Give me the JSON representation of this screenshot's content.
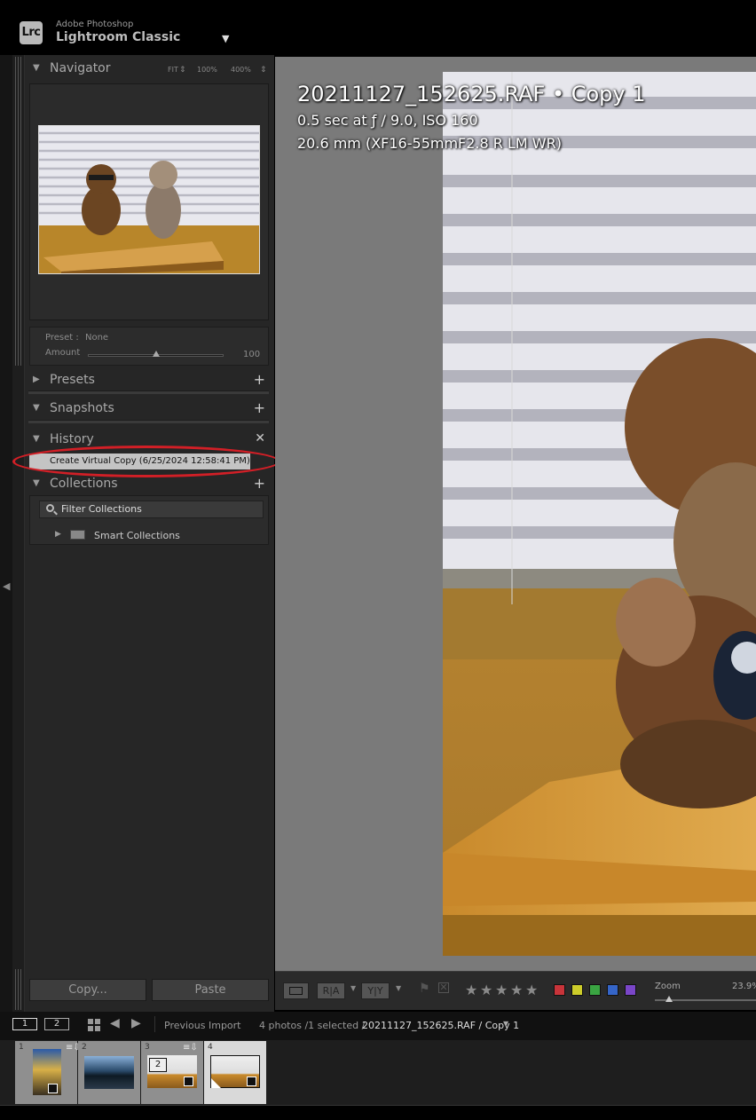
{
  "app": {
    "logo": "Lrc",
    "brand_small": "Adobe Photoshop",
    "brand_big": "Lightroom Classic"
  },
  "navigator": {
    "title": "Navigator",
    "zoom_fit": "FIT",
    "zoom_100": "100%",
    "zoom_400": "400%"
  },
  "quick_develop": {
    "preset_label": "Preset :",
    "preset_value": "None",
    "amount_label": "Amount",
    "amount_value": "100",
    "amount_level": 0.5
  },
  "panels": {
    "presets": "Presets",
    "snapshots": "Snapshots",
    "history": "History",
    "collections": "Collections"
  },
  "history": {
    "items": [
      "Create Virtual Copy (6/25/2024 12:58:41 PM)"
    ]
  },
  "collections": {
    "filter_placeholder": "Filter Collections",
    "smart": "Smart Collections"
  },
  "buttons": {
    "copy": "Copy...",
    "paste": "Paste"
  },
  "photo_info": {
    "title": "20211127_152625.RAF  •  Copy 1",
    "exposure": "0.5 sec at ƒ / 9.0, ISO 160",
    "lens": "20.6 mm (XF16-55mmF2.8 R LM WR)"
  },
  "toolbar": {
    "ra_label": "R|A",
    "yy_label": "Y|Y",
    "zoom_label": "Zoom",
    "zoom_value": "23.9%",
    "colors": [
      "#c8343a",
      "#cccc2a",
      "#3aa542",
      "#3565c8",
      "#7a46c8"
    ]
  },
  "filmstrip": {
    "screen1": "1",
    "screen2": "2",
    "source": "Previous Import",
    "count": "4 photos /1 selected /",
    "filename": "20211127_152625.RAF / Copy 1",
    "cells": [
      {
        "num": "1"
      },
      {
        "num": "2"
      },
      {
        "num": "3",
        "stack": "2"
      },
      {
        "num": "4"
      }
    ]
  }
}
